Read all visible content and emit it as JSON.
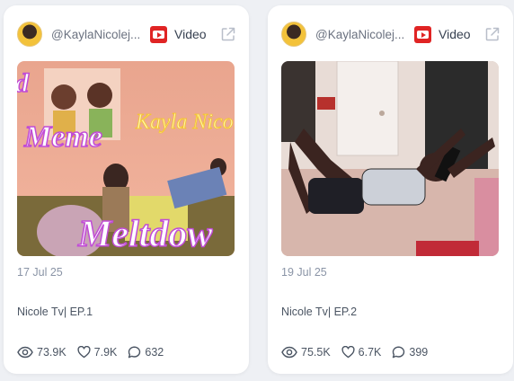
{
  "cards": [
    {
      "handle": "@KaylaNicolej...",
      "type_label": "Video",
      "date": "17 Jul 25",
      "title": "Nicole Tv| EP.1",
      "views": "73.9K",
      "likes": "7.9K",
      "comments": "632",
      "thumbnail_text": {
        "line1": "d",
        "line2": "Meme",
        "line3": "Meltdow",
        "neon": "Kayla Nicole"
      }
    },
    {
      "handle": "@KaylaNicolej...",
      "type_label": "Video",
      "date": "19 Jul 25",
      "title": "Nicole Tv| EP.2",
      "views": "75.5K",
      "likes": "6.7K",
      "comments": "399"
    }
  ],
  "colors": {
    "youtube_red": "#e02424",
    "muted_text": "#8a94a6",
    "body_text": "#4b5563"
  },
  "icons": {
    "source": "youtube-icon",
    "external": "external-link-icon",
    "views": "eye-icon",
    "likes": "heart-icon",
    "comments": "comment-icon"
  }
}
